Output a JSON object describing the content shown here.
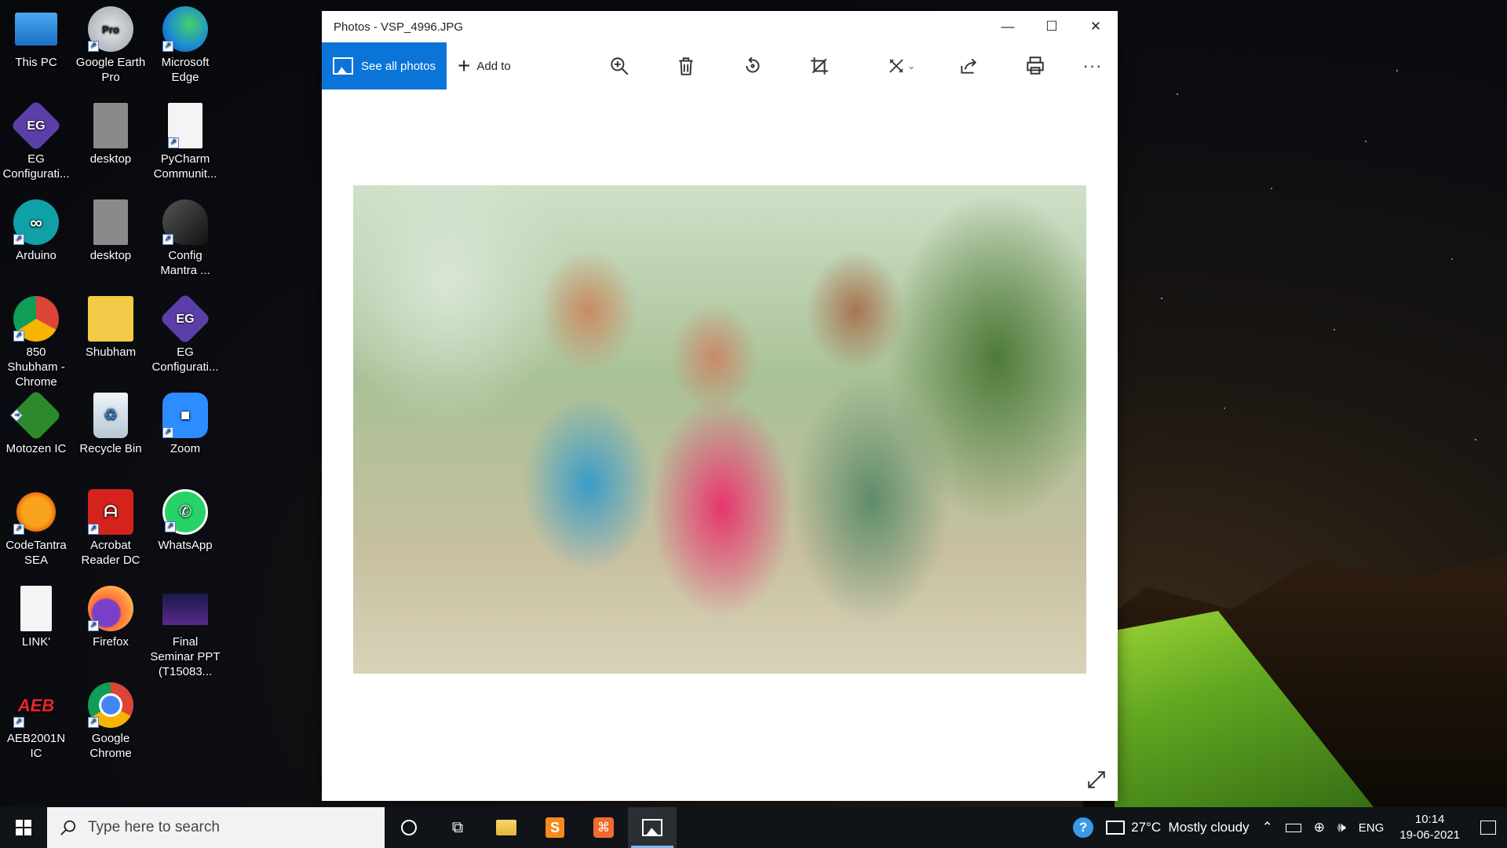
{
  "desktop": {
    "icons": [
      {
        "label": "This PC"
      },
      {
        "label": "Google Earth Pro"
      },
      {
        "label": "Microsoft Edge"
      },
      {
        "label": "EG Configurati..."
      },
      {
        "label": "desktop"
      },
      {
        "label": "PyCharm Communit..."
      },
      {
        "label": "Arduino"
      },
      {
        "label": "desktop"
      },
      {
        "label": "Config Mantra ..."
      },
      {
        "label": "850 Shubham - Chrome"
      },
      {
        "label": "Shubham"
      },
      {
        "label": "EG Configurati..."
      },
      {
        "label": "Motozen IC"
      },
      {
        "label": "Recycle Bin"
      },
      {
        "label": "Zoom"
      },
      {
        "label": "CodeTantra SEA"
      },
      {
        "label": "Acrobat Reader DC"
      },
      {
        "label": "WhatsApp"
      },
      {
        "label": "LINK'"
      },
      {
        "label": "Firefox"
      },
      {
        "label": "Final Seminar PPT (T15083..."
      },
      {
        "label": "AEB2001N IC"
      },
      {
        "label": "Google Chrome"
      }
    ]
  },
  "window": {
    "title": "Photos - VSP_4996.JPG",
    "see_all_label": "See all photos",
    "add_to_label": "Add to",
    "pro_badge": "Pro",
    "eg_badge": "EG",
    "aeb_badge": "AEB"
  },
  "taskbar": {
    "search_placeholder": "Type here to search",
    "weather": "27°C  Mostly cloudy",
    "language": "ENG",
    "time": "10:14",
    "date": "19-06-2021"
  },
  "colors": {
    "accent": "#0a74d9",
    "taskbar": "#101317"
  }
}
